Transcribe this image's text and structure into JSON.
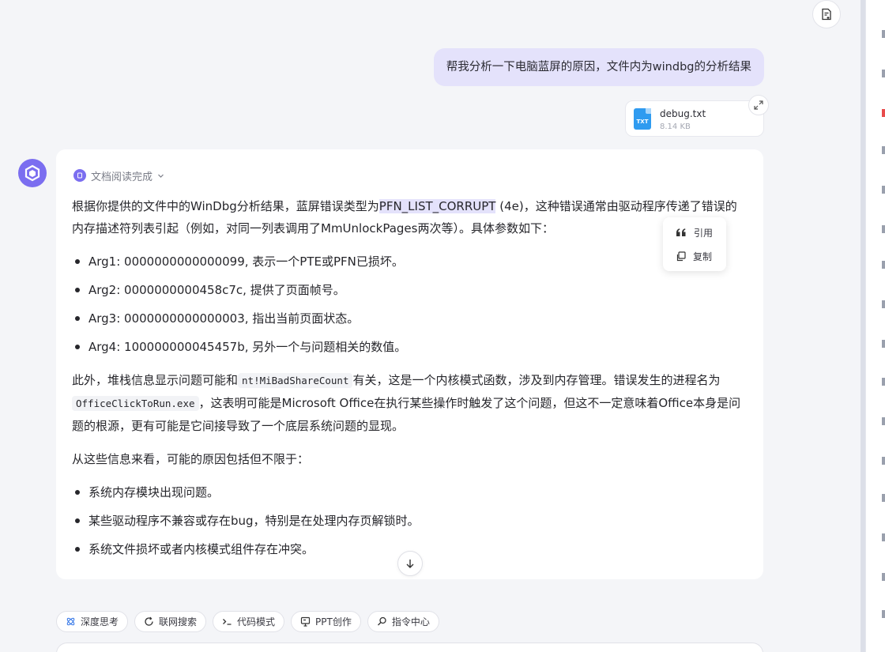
{
  "user_message": "帮我分析一下电脑蓝屏的原因，文件内为windbg的分析结果",
  "file": {
    "badge": "TXT",
    "name": "debug.txt",
    "size": "8.14 KB"
  },
  "doc_status": "文档阅读完成",
  "answer": {
    "p1_pre": "根据你提供的文件中的WinDbg分析结果，蓝屏错误类型为",
    "p1_highlight": "PFN_LIST_CORRUPT",
    "p1_post": " (4e)，这种错误通常由驱动程序传递了错误的内存描述符列表引起（例如，对同一列表调用了MmUnlockPages两次等）。具体参数如下：",
    "args": [
      "Arg1: 0000000000000099, 表示一个PTE或PFN已损坏。",
      "Arg2: 0000000000458c7c, 提供了页面帧号。",
      "Arg3: 0000000000000003, 指出当前页面状态。",
      "Arg4: 100000000045457b, 另外一个与问题相关的数值。"
    ],
    "p2_a": "此外，堆栈信息显示问题可能和",
    "p2_code1": "nt!MiBadShareCount",
    "p2_b": "有关，这是一个内核模式函数，涉及到内存管理。错误发生的进程名为",
    "p2_code2": "OfficeClickToRun.exe",
    "p2_c": "，这表明可能是Microsoft Office在执行某些操作时触发了这个问题，但这不一定意味着Office本身是问题的根源，更有可能是它间接导致了一个底层系统问题的显现。",
    "p3": "从这些信息来看，可能的原因包括但不限于：",
    "causes": [
      "系统内存模块出现问题。",
      "某些驱动程序不兼容或存在bug，特别是在处理内存页解锁时。",
      "系统文件损坏或者内核模式组件存在冲突。"
    ]
  },
  "context_menu": {
    "quote": "引用",
    "copy": "复制"
  },
  "toolbar": {
    "deep_think": "深度思考",
    "web_search": "联网搜索",
    "code_mode": "代码模式",
    "ppt": "PPT创作",
    "commands": "指令中心"
  },
  "colors": {
    "accent": "#7b6ef0",
    "user_bubble": "#e4e2fb",
    "file_icon": "#2f9bf0"
  }
}
